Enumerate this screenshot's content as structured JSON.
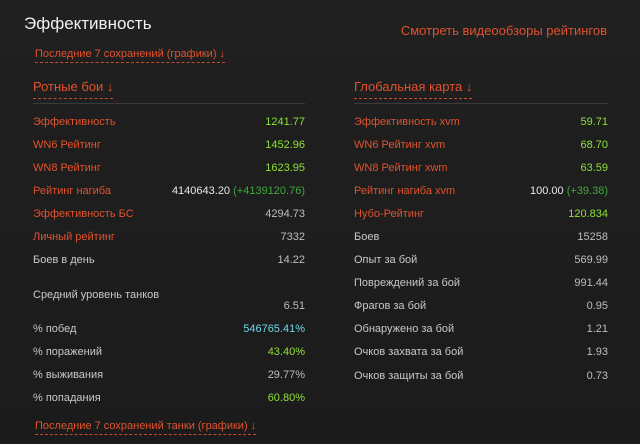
{
  "header": {
    "title": "Эффективность",
    "video_link": "Смотреть видеообзоры рейтингов",
    "history_top": "Последние 7 сохранений (графики) ↓",
    "history_bottom": "Последние 7 сохранений танки (графики) ↓"
  },
  "colors": {
    "accent": "#e2522d",
    "good": "#8ee036",
    "great": "#6fd7e8"
  },
  "company": {
    "title": "Ротные бои ↓",
    "rows": [
      {
        "label": "Эффективность",
        "value": "1241.77"
      },
      {
        "label": "WN6 Рейтинг",
        "value": "1452.96"
      },
      {
        "label": "WN8 Рейтинг",
        "value": "1623.95"
      },
      {
        "label": "Рейтинг нагиба",
        "value": "4140643.20",
        "delta": "(+4139120.76)"
      },
      {
        "label": "Эффективность БС",
        "value": "4294.73"
      },
      {
        "label": "Личный рейтинг",
        "value": "7332"
      },
      {
        "label": "Боев в день",
        "value": "14.22"
      },
      {
        "label": "Средний уровень танков",
        "value": "6.51"
      },
      {
        "label": "% побед",
        "value": "546765.41%"
      },
      {
        "label": "% поражений",
        "value": "43.40%"
      },
      {
        "label": "% выживания",
        "value": "29.77%"
      },
      {
        "label": "% попадания",
        "value": "60.80%"
      }
    ]
  },
  "global": {
    "title": "Глобальная карта ↓",
    "rows": [
      {
        "label": "Эффективность xvm",
        "value": "59.71"
      },
      {
        "label": "WN6 Рейтинг xvm",
        "value": "68.70"
      },
      {
        "label": "WN8 Рейтинг xwm",
        "value": "63.59"
      },
      {
        "label": "Рейтинг нагиба xvm",
        "value": "100.00",
        "delta": "(+39.38)"
      },
      {
        "label": "Нубо-Рейтинг",
        "value": "120.834"
      },
      {
        "label": "Боев",
        "value": "15258"
      },
      {
        "label": "Опыт за бой",
        "value": "569.99"
      },
      {
        "label": "Повреждений за бой",
        "value": "991.44"
      },
      {
        "label": "Фрагов за бой",
        "value": "0.95"
      },
      {
        "label": "Обнаружено за бой",
        "value": "1.21"
      },
      {
        "label": "Очков захвата за бой",
        "value": "1.93"
      },
      {
        "label": "Очков защиты за бой",
        "value": "0.73"
      }
    ]
  }
}
